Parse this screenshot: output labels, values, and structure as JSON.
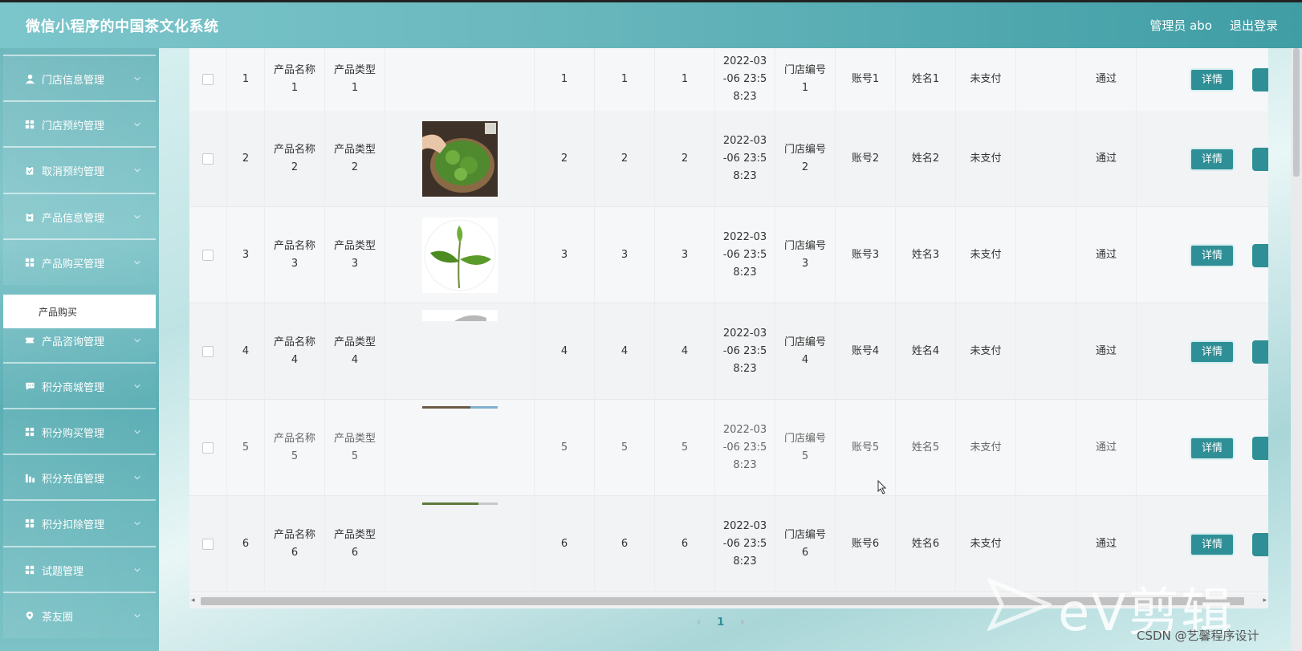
{
  "header": {
    "title": "微信小程序的中国茶文化系统",
    "user": "管理员 abo",
    "logout": "退出登录"
  },
  "sidebar": {
    "items": [
      {
        "label": "门店信息管理",
        "icon": "user-icon"
      },
      {
        "label": "门店预约管理",
        "icon": "grid-icon"
      },
      {
        "label": "取消预约管理",
        "icon": "clipboard-icon"
      },
      {
        "label": "产品信息管理",
        "icon": "clipboard-x-icon"
      },
      {
        "label": "产品购买管理",
        "icon": "grid-icon"
      },
      {
        "label": "产品咨询管理",
        "icon": "ticket-icon"
      },
      {
        "label": "积分商城管理",
        "icon": "chat-icon"
      },
      {
        "label": "积分购买管理",
        "icon": "grid-icon"
      },
      {
        "label": "积分充值管理",
        "icon": "bar-chart-icon"
      },
      {
        "label": "积分扣除管理",
        "icon": "grid-icon"
      },
      {
        "label": "试题管理",
        "icon": "grid-icon"
      },
      {
        "label": "茶友圈",
        "icon": "location-icon"
      }
    ],
    "active_sub": "产品购买"
  },
  "table": {
    "rows": [
      {
        "idx": "1",
        "name": "产品名称\n1",
        "type": "产品类型\n1",
        "image": "none",
        "a": "1",
        "b": "1",
        "c": "1",
        "time": "2022-03\n-06 23:5\n8:23",
        "store": "门店编号\n1",
        "account": "账号1",
        "username": "姓名1",
        "pay": "未支付",
        "status": "通过"
      },
      {
        "idx": "2",
        "name": "产品名称\n2",
        "type": "产品类型\n2",
        "image": "tea-basket",
        "a": "2",
        "b": "2",
        "c": "2",
        "time": "2022-03\n-06 23:5\n8:23",
        "store": "门店编号\n2",
        "account": "账号2",
        "username": "姓名2",
        "pay": "未支付",
        "status": "通过"
      },
      {
        "idx": "3",
        "name": "产品名称\n3",
        "type": "产品类型\n3",
        "image": "tea-sprout",
        "a": "3",
        "b": "3",
        "c": "3",
        "time": "2022-03\n-06 23:5\n8:23",
        "store": "门店编号\n3",
        "account": "账号3",
        "username": "姓名3",
        "pay": "未支付",
        "status": "通过"
      },
      {
        "idx": "4",
        "name": "产品名称\n4",
        "type": "产品类型\n4",
        "image": "partial-1",
        "a": "4",
        "b": "4",
        "c": "4",
        "time": "2022-03\n-06 23:5\n8:23",
        "store": "门店编号\n4",
        "account": "账号4",
        "username": "姓名4",
        "pay": "未支付",
        "status": "通过"
      },
      {
        "idx": "5",
        "name": "产品名称\n5",
        "type": "产品类型\n5",
        "image": "partial-2",
        "a": "5",
        "b": "5",
        "c": "5",
        "time": "2022-03\n-06 23:5\n8:23",
        "store": "门店编号\n5",
        "account": "账号5",
        "username": "姓名5",
        "pay": "未支付",
        "status": "通过"
      },
      {
        "idx": "6",
        "name": "产品名称\n6",
        "type": "产品类型\n6",
        "image": "partial-3",
        "a": "6",
        "b": "6",
        "c": "6",
        "time": "2022-03\n-06 23:5\n8:23",
        "store": "门店编号\n6",
        "account": "账号6",
        "username": "姓名6",
        "pay": "未支付",
        "status": "通过"
      }
    ],
    "detail_label": "详情"
  },
  "pagination": {
    "prev": "‹",
    "current": "1",
    "next": "›"
  },
  "watermark": {
    "brand": "eV剪辑",
    "credit": "CSDN @艺馨程序设计"
  },
  "colors": {
    "accent": "#2f8f97",
    "header_start": "#7bc6cb",
    "header_end": "#3f9da4"
  }
}
